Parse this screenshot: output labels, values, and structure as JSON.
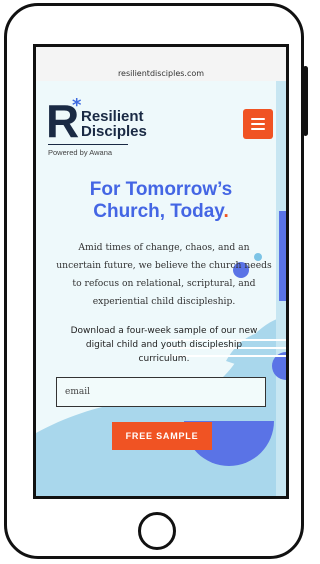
{
  "browser": {
    "url": "resilientdisciples.com"
  },
  "logo": {
    "mark": "R",
    "star": "*",
    "name_line1": "Resilient",
    "name_line2": "Disciples",
    "powered_by": "Powered by Awana"
  },
  "menu": {
    "icon": "hamburger-icon"
  },
  "hero": {
    "headline_line1": "For Tomorrow’s",
    "headline_line2": "Church, Today",
    "headline_period": ".",
    "body_lines": [
      "Amid times of change, chaos, and an",
      "uncertain future, we believe the church needs",
      "to refocus on relational, scriptural, and",
      "experiential child discipleship."
    ],
    "download_lines": [
      "Download a four-week sample of our new",
      "digital child and youth discipleship",
      "curriculum."
    ]
  },
  "form": {
    "email_placeholder": "email",
    "submit_label": "FREE SAMPLE"
  },
  "colors": {
    "accent_orange": "#f05323",
    "headline_blue": "#4466e4",
    "navy": "#1a2a44",
    "page_bg": "#eef9fb",
    "shape_light_blue": "#a9d7ec",
    "shape_blue": "#5a73e6"
  }
}
